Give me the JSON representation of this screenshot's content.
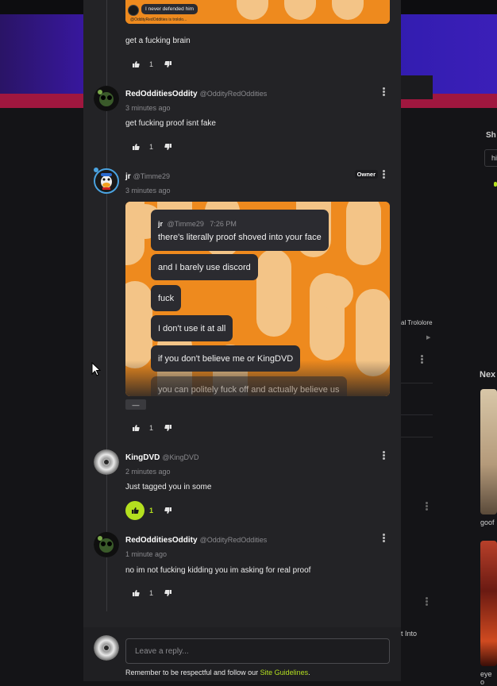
{
  "quoted_top": {
    "bubble": "I never defended him",
    "caption": "@OddityRedOddities is trololo..."
  },
  "comments": [
    {
      "body": "get a fucking brain",
      "likes": "1"
    },
    {
      "username": "RedOdditiesOddity",
      "handle": "@OddityRedOddities",
      "time": "3 minutes ago",
      "body": "get fucking proof isnt fake",
      "likes": "1"
    },
    {
      "username": "jr",
      "handle": "@Timme29",
      "time": "3 minutes ago",
      "badge": "Owner",
      "likes": "1",
      "collapse_label": "—",
      "screenshot": {
        "header_name": "jr",
        "header_handle": "@Timme29",
        "header_time": "7:26 PM",
        "messages": [
          "there's literally proof shoved into your face",
          "and I barely use discord",
          "fuck",
          "I don't use it at all",
          "if you don't believe me or KingDVD",
          "you can politely fuck off and actually believe us"
        ]
      }
    },
    {
      "username": "KingDVD",
      "handle": "@KingDVD",
      "time": "2 minutes ago",
      "body": "Just tagged you in some",
      "likes": "1"
    },
    {
      "username": "RedOdditiesOddity",
      "handle": "@OddityRedOddities",
      "time": "1 minute ago",
      "body": "no im not fucking kidding you im asking for real proof",
      "likes": "1"
    }
  ],
  "reply": {
    "placeholder": "Leave a reply...",
    "guidelines_prefix": "Remember to be respectful and follow our ",
    "guidelines_link": "Site Guidelines",
    "guidelines_suffix": "."
  },
  "background": {
    "right_label_1": "Sh",
    "right_label_2": "hi",
    "right_label_3": "al Trololore",
    "right_label_4": "Nex",
    "right_label_5": "goof",
    "right_label_6": "t Into",
    "right_label_7": "eye o"
  },
  "colors": {
    "accent": "#b4e01f",
    "panel": "#232326"
  }
}
